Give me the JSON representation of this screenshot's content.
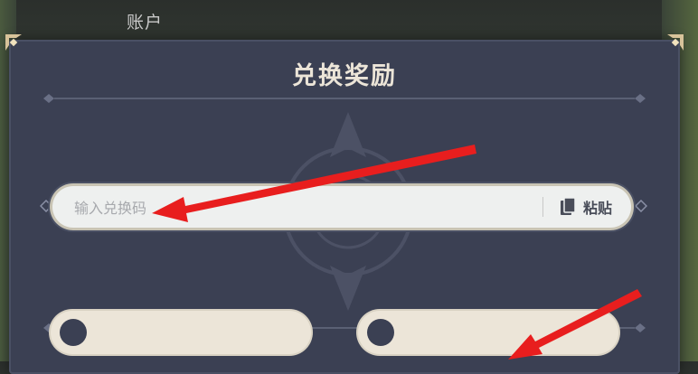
{
  "header": {
    "account_label": "账户"
  },
  "dialog": {
    "title": "兑换奖励",
    "input": {
      "placeholder": "输入兑换码",
      "value": ""
    },
    "paste": {
      "label": "粘贴",
      "icon": "clipboard-icon"
    }
  },
  "colors": {
    "panel": "#3b4053",
    "title": "#ece5d8",
    "input_bg": "#eef0ef",
    "button_bg": "#ece5d8",
    "arrow": "#e81e1e"
  }
}
